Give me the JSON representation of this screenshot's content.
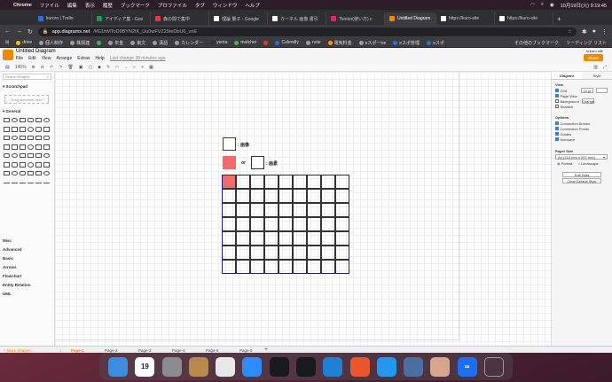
{
  "menubar": {
    "app": "Chrome",
    "items": [
      "ファイル",
      "編集",
      "表示",
      "履歴",
      "ブックマーク",
      "プロファイル",
      "タブ",
      "ウィンドウ",
      "ヘルプ"
    ],
    "clock": "10月19日(火) 9:19:45"
  },
  "tabs": [
    {
      "label": "kuroro | Trello",
      "color": "#2d6cdf"
    },
    {
      "label": "アイディア集 - Goo",
      "color": "#0f9d58"
    },
    {
      "label": "森の間で集中",
      "color": "#e53935"
    },
    {
      "label": "理論 量子 - Google",
      "color": "#ffffff"
    },
    {
      "label": "カーネル 画像 書引",
      "color": "#ffffff"
    },
    {
      "label": "Tkinter(使い方) c",
      "color": "#e91e63"
    },
    {
      "label": "Untitled Diagram",
      "color": "#f08705"
    },
    {
      "label": "https://kuro-site",
      "color": "#ffffff"
    },
    {
      "label": "https://kuro-site",
      "color": "#ffffff"
    }
  ],
  "address": {
    "host": "app.diagrams.net",
    "path": "/#G1hMToD9BYN2IK_Uu0wFVZ29teDbU6_vnE"
  },
  "bookmarks": [
    {
      "label": "drive",
      "color": "#fbbc04"
    },
    {
      "label": "個人制作",
      "color": "#9e9e9e"
    },
    {
      "label": "株関連",
      "color": "#9e9e9e"
    },
    {
      "label": "",
      "color": "#4caf50"
    },
    {
      "label": "年金",
      "color": "#9e9e9e"
    },
    {
      "label": "東文",
      "color": "#9e9e9e"
    },
    {
      "label": "漢語",
      "color": "#9e9e9e"
    },
    {
      "label": "カレンダー",
      "color": "#9e9e9e"
    },
    {
      "label": "yenta",
      "color": "#333333"
    },
    {
      "label": "matcher",
      "color": "#4caf50"
    },
    {
      "label": "",
      "color": "#e53935"
    },
    {
      "label": "Calendly",
      "color": "#2d6cdf"
    },
    {
      "label": "note",
      "color": "#9e9e9e"
    },
    {
      "label": "電気料金",
      "color": "#ff9800"
    },
    {
      "label": "eスポーtre",
      "color": "#9e9e9e"
    },
    {
      "label": "eスポ管理",
      "color": "#2d6cdf"
    },
    {
      "label": "eスポ",
      "color": "#2d6cdf"
    }
  ],
  "bookmarks_more": "その他のブックマーク",
  "reading_list": "リーディング リスト",
  "drawio": {
    "file_title": "Untitled Diagram",
    "menu": [
      "File",
      "Edit",
      "View",
      "Arrange",
      "Extras",
      "Help"
    ],
    "unsaved": "Last change 38 minutes ago",
    "user": "kuroro.site",
    "share": "Share",
    "zoom": "140%",
    "search_placeholder": "Search Shapes",
    "scratchpad": "Scratchpad",
    "drop_hint": "Drag elements here",
    "general": "General",
    "sections": [
      "Misc",
      "Advanced",
      "Basic",
      "Arrows",
      "Flowchart",
      "Entity Relation",
      "UML"
    ],
    "more_shapes": "+ More Shapes...",
    "pages": [
      "Page-1",
      "Page-2",
      "Page-3",
      "Page-4",
      "Page-5",
      "Page-6"
    ],
    "legend": {
      "image_label": ": 画像",
      "or_label": "or",
      "pixel_label": ": 画素"
    },
    "grid": {
      "rows": 7,
      "cols": 9,
      "filled": [
        [
          0,
          0
        ]
      ]
    },
    "colors": {
      "frame": "#1f1f8f",
      "fill": "#f26b6b",
      "accent": "#f08705"
    },
    "right": {
      "tabs": [
        "Diagram",
        "Style"
      ],
      "view_title": "View",
      "view_items": [
        {
          "label": "Grid",
          "on": true
        },
        {
          "label": "Page View",
          "on": true
        },
        {
          "label": "Background",
          "on": false
        },
        {
          "label": "Shadow",
          "on": false
        }
      ],
      "grid_size": "10 pt",
      "change": "Change",
      "options_title": "Options",
      "option_items": [
        {
          "label": "Connection Arrows",
          "on": true
        },
        {
          "label": "Connection Points",
          "on": true
        },
        {
          "label": "Guides",
          "on": true
        },
        {
          "label": "Autosave",
          "on": true
        }
      ],
      "paper_title": "Paper Size",
      "paper_value": "A4 (210 mm x 297 mm)",
      "portrait": "Portrait",
      "landscape": "Landscape",
      "edit_data": "Edit Data",
      "clear_style": "Clear Default Style"
    }
  },
  "dock": [
    {
      "name": "finder",
      "color": "#3c8de0",
      "glyph": ""
    },
    {
      "name": "calendar",
      "color": "#ffffff",
      "glyph": "19"
    },
    {
      "name": "system-preferences",
      "color": "#8c8c8c",
      "glyph": ""
    },
    {
      "name": "notes",
      "color": "#b58a4c",
      "glyph": ""
    },
    {
      "name": "chrome",
      "color": "#e8e8e8",
      "glyph": ""
    },
    {
      "name": "zoom",
      "color": "#2d8cff",
      "glyph": ""
    },
    {
      "name": "terminal-1",
      "color": "#1a1a1a",
      "glyph": ""
    },
    {
      "name": "terminal-2",
      "color": "#1a1a1a",
      "glyph": ""
    },
    {
      "name": "vscode",
      "color": "#1f7fd4",
      "glyph": ""
    },
    {
      "name": "draw-app",
      "color": "#e8562a",
      "glyph": ""
    },
    {
      "name": "docker",
      "color": "#2496ed",
      "glyph": ""
    },
    {
      "name": "quicktime",
      "color": "#4a6ea0",
      "glyph": ""
    },
    {
      "name": "preview",
      "color": "#d6a58c",
      "glyph": ""
    },
    {
      "name": "infinity-app",
      "color": "#1e6ff0",
      "glyph": "∞"
    },
    {
      "name": "trash",
      "color": "#6a6a6a",
      "glyph": ""
    }
  ]
}
